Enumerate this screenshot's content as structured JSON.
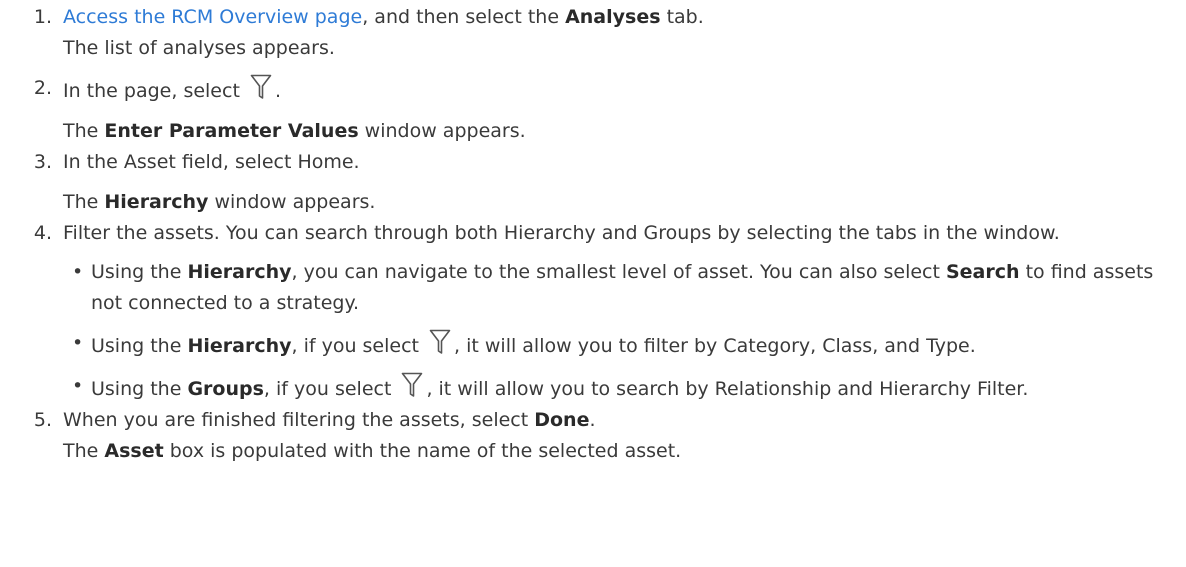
{
  "steps": [
    {
      "num": "1",
      "link": "Access the RCM Overview page",
      "text_a": ", and then select the ",
      "bold_a": "Analyses",
      "text_b": " tab.",
      "result": "The list of analyses appears."
    },
    {
      "num": "2",
      "text_a": "In the page, select ",
      "icon": "filter-icon",
      "text_b": ".",
      "result_bold": "Enter Parameter Values",
      "result_text": " window appears.",
      "result_pre": "The "
    },
    {
      "num": "3",
      "text_a": "In the Asset field, select Home.",
      "result_pre": "The ",
      "result_bold": "Hierarchy",
      "result_text": " window appears."
    },
    {
      "num": "4",
      "text_a": "Filter the assets. You can search through both Hierarchy and Groups by selecting the tabs in the window.",
      "bullets": [
        {
          "pre": "Using the ",
          "bold": "Hierarchy",
          "mid": ", you can navigate to the smallest level of asset. You can also select ",
          "bold2": "Search",
          "post": " to find assets not connected to a strategy."
        },
        {
          "pre": "Using the ",
          "bold": "Hierarchy",
          "mid": ", if you select ",
          "icon": "filter-icon",
          "post": ", it will allow you to filter by Category, Class, and Type."
        },
        {
          "pre": "Using the ",
          "bold": "Groups",
          "mid": ", if you select ",
          "icon": "filter-icon",
          "post": ", it will allow you to search by Relationship and Hierarchy Filter."
        }
      ]
    },
    {
      "num": "5",
      "text_a": "When you are finished filtering the assets, select ",
      "bold_a": "Done",
      "text_b": ".",
      "result_pre": "The ",
      "result_bold": "Asset",
      "result_text": " box is populated with the name of the selected asset."
    }
  ],
  "colors": {
    "text": "#3a3a3a",
    "link": "#2e7bd6",
    "icon_stroke": "#555555"
  }
}
